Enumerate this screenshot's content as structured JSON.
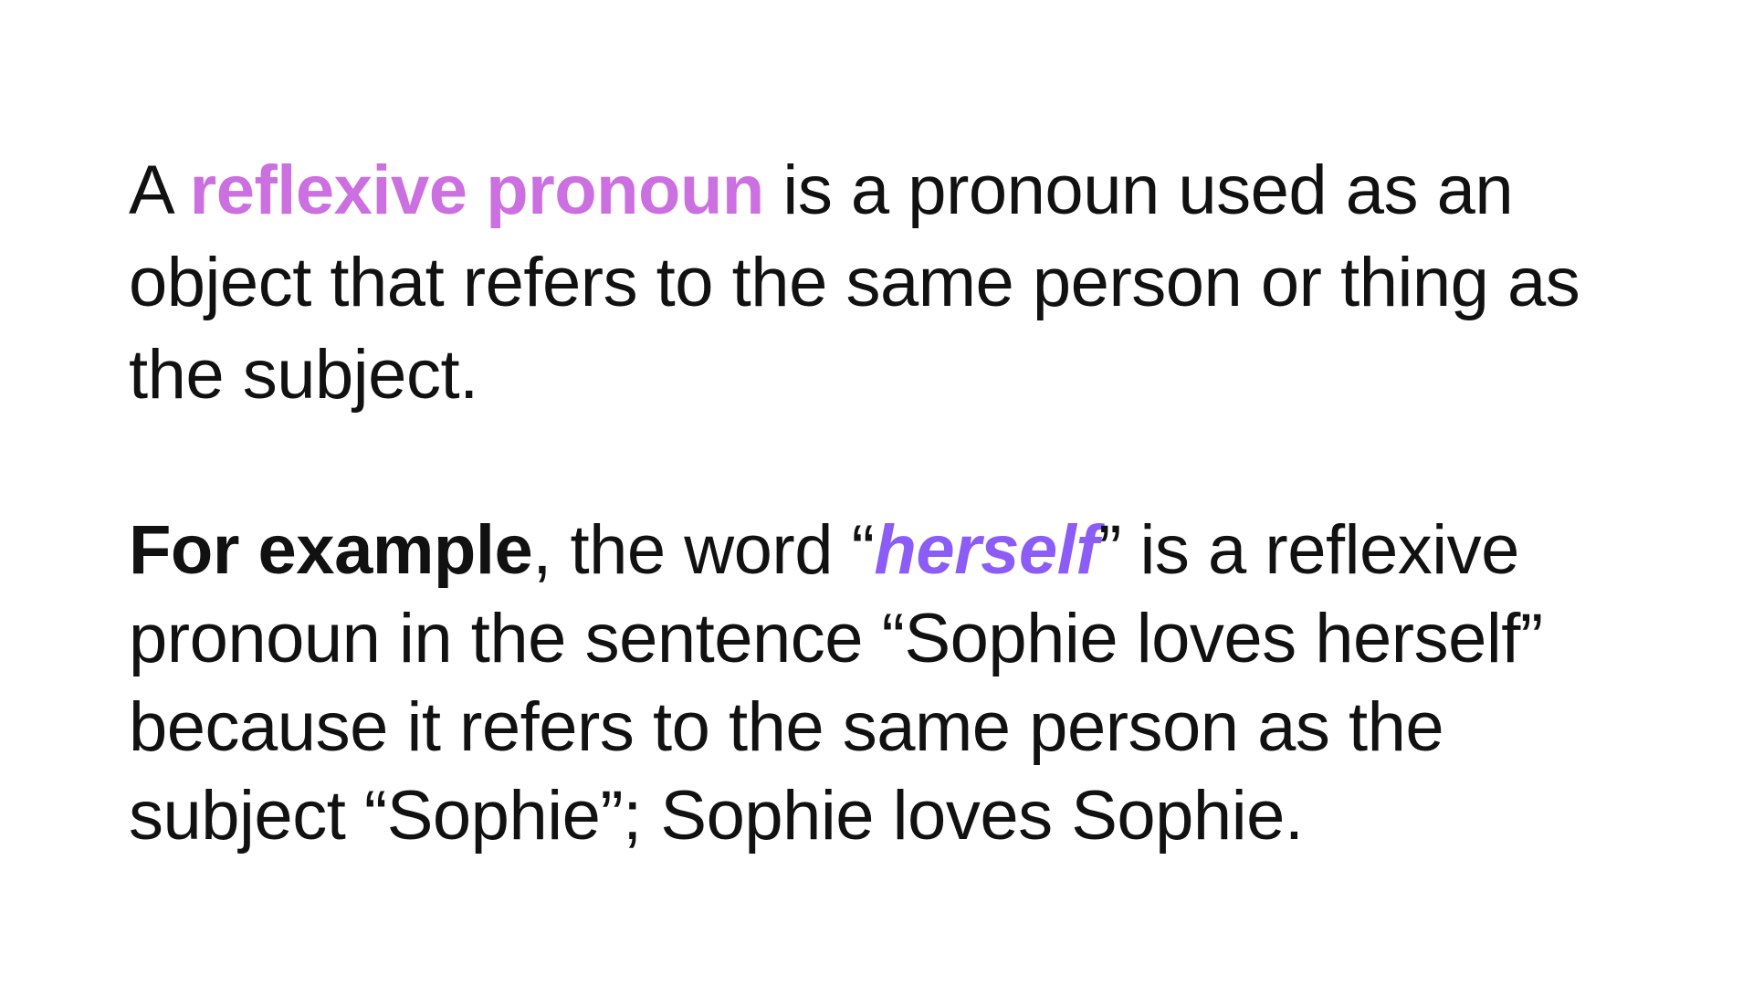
{
  "colors": {
    "background": "#ffffff",
    "text": "#111111",
    "term_accent": "#cc6fe0",
    "example_word_accent": "#8b5cf6"
  },
  "definition": {
    "before_term": "A ",
    "term": "reflexive pronoun",
    "after_term": " is a pronoun used as an object that refers to the same person or thing as the subject."
  },
  "example": {
    "lead": "For example",
    "after_lead": ", the word “",
    "word": "herself",
    "after_word": "” is a reflexive pronoun in the sentence “Sophie loves herself” because it refers to the same person as the subject “Sophie”; Sophie loves Sophie."
  }
}
